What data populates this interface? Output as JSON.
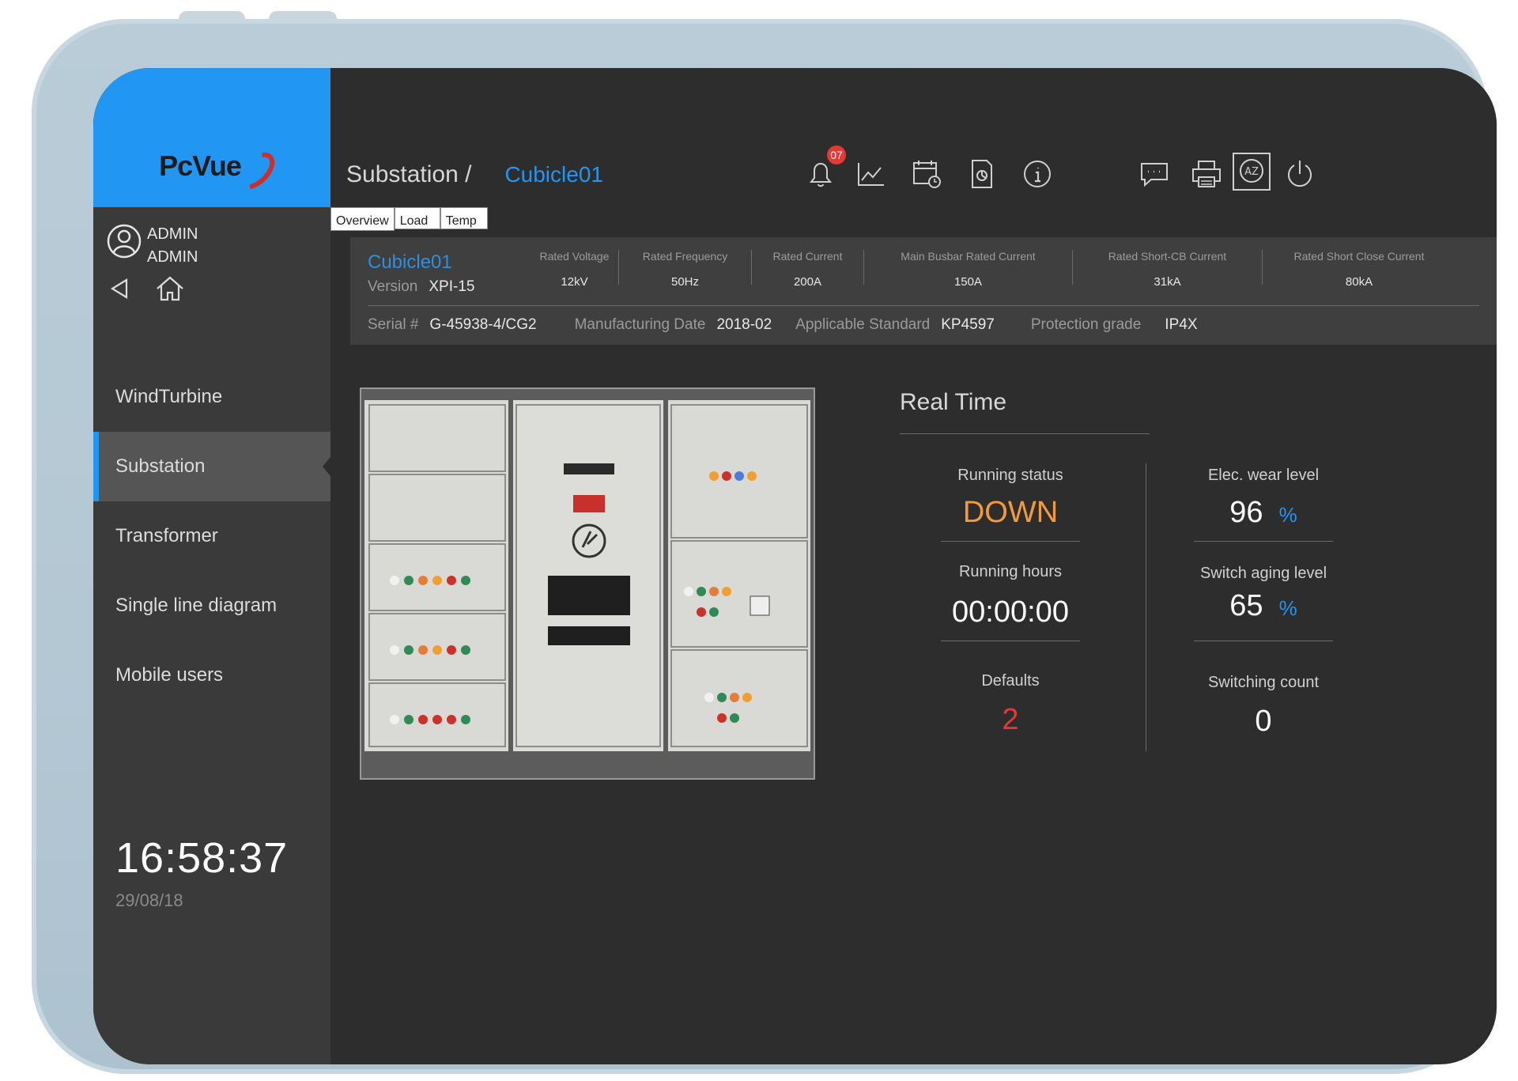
{
  "app": {
    "logo_text": "PcVue"
  },
  "user": {
    "name": "ADMIN",
    "role": "ADMIN"
  },
  "sidebar": {
    "items": [
      {
        "label": "WindTurbine"
      },
      {
        "label": "Substation"
      },
      {
        "label": "Transformer"
      },
      {
        "label": "Single line diagram"
      },
      {
        "label": "Mobile users"
      }
    ],
    "active_item": "Substation",
    "clock": "16:58:37",
    "date": "29/08/18"
  },
  "header": {
    "breadcrumb_parent": "Substation /",
    "breadcrumb_current": "Cubicle01",
    "alarm_count": "07"
  },
  "tabs": [
    {
      "label": "Overview"
    },
    {
      "label": "Load"
    },
    {
      "label": "Temp"
    }
  ],
  "cubicle": {
    "title": "Cubicle01",
    "version_label": "Version",
    "version": "XPI-15",
    "ratings": [
      {
        "label": "Rated Voltage",
        "value": "12kV"
      },
      {
        "label": "Rated Frequency",
        "value": "50Hz"
      },
      {
        "label": "Rated Current",
        "value": "200A"
      },
      {
        "label": "Main Busbar Rated Current",
        "value": "150A"
      },
      {
        "label": "Rated Short-CB Current",
        "value": "31kA"
      },
      {
        "label": "Rated Short Close Current",
        "value": "80kA"
      }
    ],
    "serial_label": "Serial #",
    "serial": "G-45938-4/CG2",
    "mfg_label": "Manufacturing Date",
    "mfg": "2018-02",
    "standard_label": "Applicable Standard",
    "standard": "KP4597",
    "protection_label": "Protection grade",
    "protection": "IP4X"
  },
  "realtime": {
    "title": "Real Time",
    "running_status_label": "Running status",
    "running_status": "DOWN",
    "running_hours_label": "Running hours",
    "running_hours": "00:00:00",
    "defaults_label": "Defaults",
    "defaults": "2",
    "elec_wear_label": "Elec. wear level",
    "elec_wear": "96",
    "elec_wear_unit": "%",
    "switch_aging_label": "Switch aging level",
    "switch_aging": "65",
    "switch_aging_unit": "%",
    "switching_count_label": "Switching count",
    "switching_count": "0"
  },
  "colors": {
    "accent": "#2196f3",
    "status_down": "#f29b38",
    "defaults": "#e53935"
  }
}
